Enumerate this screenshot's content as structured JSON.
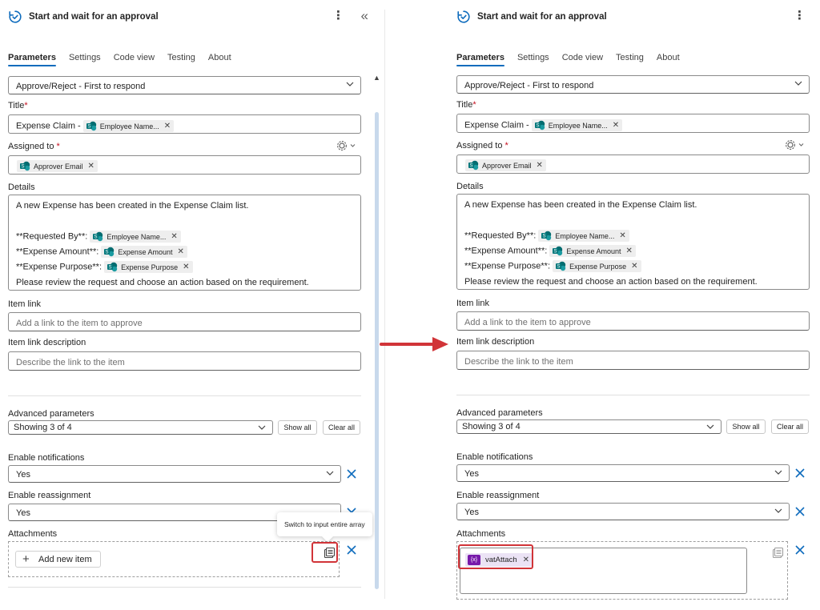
{
  "left": {
    "header": {
      "title": "Start and wait for an approval",
      "more": "⋮",
      "collapse": "«"
    },
    "tabs": [
      "Parameters",
      "Settings",
      "Code view",
      "Testing",
      "About"
    ],
    "approval_type": {
      "value": "Approve/Reject - First to respond"
    },
    "title_field": {
      "label": "Title",
      "prefix": "Expense Claim -",
      "token": "Employee Name..."
    },
    "assigned_to": {
      "label": "Assigned to",
      "token": "Approver Email"
    },
    "details": {
      "label": "Details",
      "line1": "A new Expense has been created in the Expense Claim list.",
      "requested_by": "**Requested By**:",
      "requested_by_token": "Employee Name...",
      "amount": "**Expense Amount**:",
      "amount_token": "Expense Amount",
      "purpose": "**Expense Purpose**:",
      "purpose_token": "Expense Purpose",
      "last": "Please review the request and choose an action based on the requirement."
    },
    "item_link": {
      "label": "Item link",
      "placeholder": "Add a link to the item to approve"
    },
    "item_link_desc": {
      "label": "Item link description",
      "placeholder": "Describe the link to the item"
    },
    "advanced": {
      "label": "Advanced parameters",
      "value": "Showing 3 of 4",
      "show_all": "Show all",
      "clear_all": "Clear all"
    },
    "enable_notifications": {
      "label": "Enable notifications",
      "value": "Yes"
    },
    "enable_reassignment": {
      "label": "Enable reassignment",
      "value": "Yes"
    },
    "attachments": {
      "label": "Attachments",
      "add_item": "Add new item",
      "tooltip": "Switch to input entire array"
    }
  },
  "right": {
    "header": {
      "title": "Start and wait for an approval",
      "more": "⋮"
    },
    "tabs": [
      "Parameters",
      "Settings",
      "Code view",
      "Testing",
      "About"
    ],
    "approval_type": {
      "value": "Approve/Reject - First to respond"
    },
    "title_field": {
      "label": "Title",
      "prefix": "Expense Claim -",
      "token": "Employee Name..."
    },
    "assigned_to": {
      "label": "Assigned to",
      "token": "Approver Email"
    },
    "details": {
      "label": "Details",
      "line1": "A new Expense has been created in the Expense Claim list.",
      "requested_by": "**Requested By**:",
      "requested_by_token": "Employee Name...",
      "amount": "**Expense Amount**:",
      "amount_token": "Expense Amount",
      "purpose": "**Expense Purpose**:",
      "purpose_token": "Expense Purpose",
      "last": "Please review the request and choose an action based on the requirement."
    },
    "item_link": {
      "label": "Item link",
      "placeholder": "Add a link to the item to approve"
    },
    "item_link_desc": {
      "label": "Item link description",
      "placeholder": "Describe the link to the item"
    },
    "advanced": {
      "label": "Advanced parameters",
      "value": "Showing 3 of 4",
      "show_all": "Show all",
      "clear_all": "Clear all"
    },
    "enable_notifications": {
      "label": "Enable notifications",
      "value": "Yes"
    },
    "enable_reassignment": {
      "label": "Enable reassignment",
      "value": "Yes"
    },
    "attachments": {
      "label": "Attachments",
      "var_badge": "{x}",
      "var_token": "vatAttach"
    }
  },
  "colors": {
    "accent": "#0f6cbd",
    "required": "#c50f1f",
    "highlight": "#d13438",
    "variable": "#7719aa",
    "sharepoint": "#038387"
  },
  "icons": [
    "approval-icon",
    "more-icon",
    "collapse-icon",
    "chevron-down-icon",
    "settings-icon",
    "sharepoint-icon",
    "dismiss-icon",
    "add-icon",
    "switch-array-icon",
    "arrow-icon"
  ]
}
